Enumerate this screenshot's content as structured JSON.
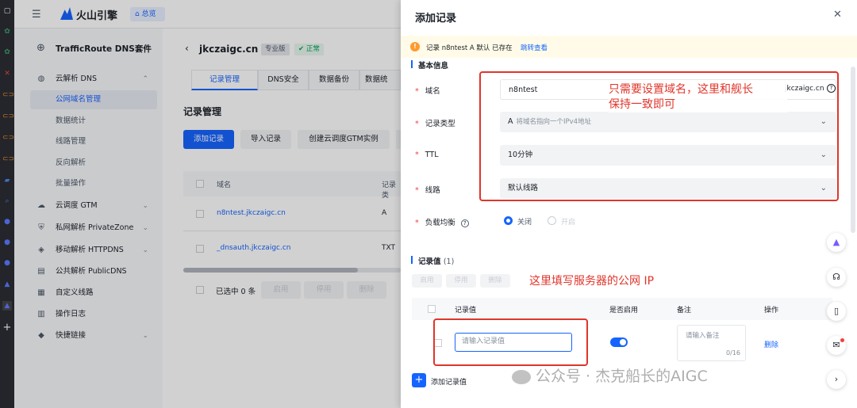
{
  "brand": {
    "name": "火山引擎",
    "home": "总览"
  },
  "sidebar": {
    "title": "TrafficRoute DNS套件",
    "items": [
      {
        "label": "云解析 DNS",
        "chev": "⌃"
      },
      {
        "label": "公网域名管理"
      },
      {
        "label": "数据统计"
      },
      {
        "label": "线路管理"
      },
      {
        "label": "反向解析"
      },
      {
        "label": "批量操作"
      },
      {
        "label": "云调度 GTM",
        "chev": "⌄"
      },
      {
        "label": "私网解析 PrivateZone",
        "chev": "⌄"
      },
      {
        "label": "移动解析 HTTPDNS",
        "chev": "⌄"
      },
      {
        "label": "公共解析 PublicDNS"
      },
      {
        "label": "自定义线路"
      },
      {
        "label": "操作日志"
      },
      {
        "label": "快捷链接",
        "chev": "⌄"
      }
    ]
  },
  "main": {
    "domain": "jkczaigc.cn",
    "badge": "专业版",
    "status": "正常",
    "tabs": [
      "记录管理",
      "DNS安全",
      "数据备份",
      "数据统"
    ],
    "section_title": "记录管理",
    "buttons": {
      "add": "添加记录",
      "import": "导入记录",
      "gtm": "创建云调度GTM实例"
    },
    "table": {
      "col_domain": "域名",
      "col_type": "记录类",
      "rows": [
        {
          "domain": "n8ntest.jkczaigc.cn",
          "type": "A"
        },
        {
          "domain": "_dnsauth.jkczaigc.cn",
          "type": "TXT"
        }
      ]
    },
    "footer": {
      "selected": "已选中 0 条",
      "enable": "启用",
      "disable": "停用",
      "delete": "删除"
    }
  },
  "drawer": {
    "title": "添加记录",
    "close": "✕",
    "notice": {
      "text": "记录 n8ntest A 默认 已存在",
      "link": "跳转查看"
    },
    "basic_title": "基本信息",
    "fields": {
      "domain_label": "域名",
      "domain_value": "n8ntest",
      "domain_suffix": "jkczaigc.cn",
      "type_label": "记录类型",
      "type_value": "A",
      "type_hint": "将域名指向一个IPv4地址",
      "ttl_label": "TTL",
      "ttl_value": "10分钟",
      "line_label": "线路",
      "line_value": "默认线路",
      "lb_label": "负载均衡",
      "lb_off": "关闭",
      "lb_on": "开启"
    },
    "records": {
      "title": "记录值",
      "count": "(1)",
      "enable": "启用",
      "disable": "停用",
      "delete": "删除",
      "col_value": "记录值",
      "col_enabled": "是否启用",
      "col_note": "备注",
      "col_action": "操作",
      "value_placeholder": "请输入记录值",
      "note_placeholder": "请输入备注",
      "note_count": "0/16",
      "row_action": "删除",
      "add_value": "添加记录值"
    },
    "annotations": {
      "top_line1": "只需要设置域名，这里和舰长",
      "top_line2": "保持一致即可",
      "bottom": "这里填写服务器的公网 IP"
    },
    "watermark": "公众号 · 杰克船长的AIGC"
  },
  "colors": {
    "primary": "#1664ff",
    "annotation": "#e0352b",
    "sidebar_bg": "#f7f8fa"
  }
}
